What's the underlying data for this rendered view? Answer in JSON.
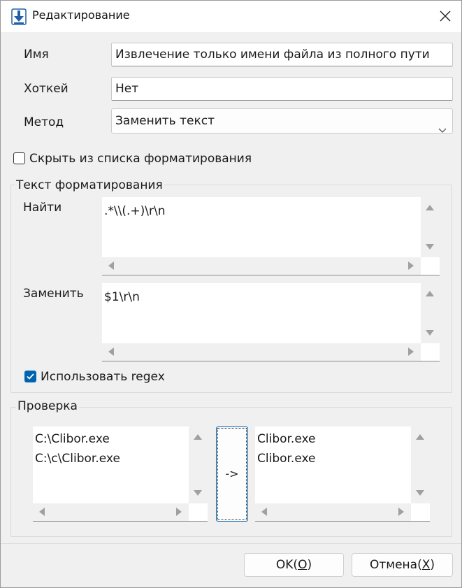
{
  "window": {
    "title": "Редактирование"
  },
  "form": {
    "name_label": "Имя",
    "name_value": "Извлечение только имени файла из полного пути",
    "hotkey_label": "Хоткей",
    "hotkey_value": "Нет",
    "method_label": "Метод",
    "method_value": "Заменить текст",
    "hide_label": "Скрыть из списка форматирования",
    "hide_checked": false
  },
  "format_group": {
    "title": "Текст форматирования",
    "find_label": "Найти",
    "find_value": ".*\\\\(.+)\\r\\n",
    "replace_label": "Заменить",
    "replace_value": "$1\\r\\n",
    "regex_label": "Использовать regex",
    "regex_checked": true
  },
  "check_group": {
    "title": "Проверка",
    "input_lines": [
      "C:\\Clibor.exe",
      "C:\\c\\Clibor.exe"
    ],
    "arrow_label": "->",
    "output_lines": [
      "Clibor.exe",
      "Clibor.exe"
    ]
  },
  "buttons": {
    "ok_text": "OK(",
    "ok_key": "O",
    "ok_end": ")",
    "cancel_text": "Отмена(",
    "cancel_key": "X",
    "cancel_end": ")"
  },
  "colors": {
    "accent": "#0063b1",
    "background": "#f0f0f0"
  },
  "icons": {
    "app": "download-arrow-icon",
    "close": "close-icon"
  }
}
